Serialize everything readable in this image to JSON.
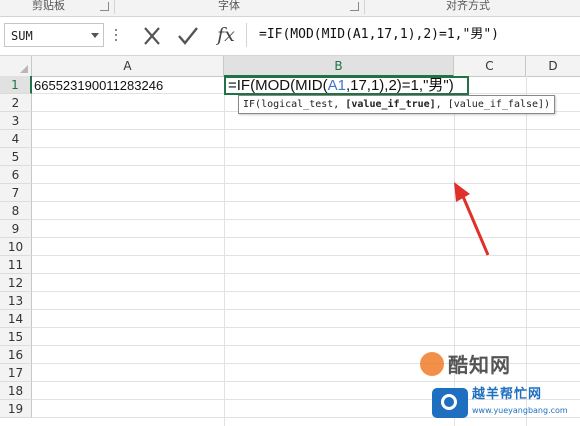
{
  "ribbon": {
    "groups": [
      "剪贴板",
      "字体",
      "对齐方式"
    ]
  },
  "formula_bar": {
    "name_box": "SUM",
    "cancel_label": "×",
    "enter_label": "✓",
    "function_label": "fx",
    "formula": "=IF(MOD(MID(A1,17,1),2)=1,\"男\")"
  },
  "columns": [
    "A",
    "B",
    "C",
    "D"
  ],
  "rows": [
    "1",
    "2",
    "3",
    "4",
    "5",
    "6",
    "7",
    "8",
    "9",
    "10",
    "11",
    "12",
    "13",
    "14",
    "15",
    "16",
    "17",
    "18",
    "19"
  ],
  "cells": {
    "A1": "665523190011283246",
    "B1_prefix": "=IF(MOD(MID(",
    "B1_ref": "A1",
    "B1_suffix": ",17,1),2)=1,\"男\")"
  },
  "tooltip": {
    "fn": "IF(",
    "arg1": "logical_test, ",
    "arg2": "[value_if_true]",
    "sep": ", ",
    "arg3": "[value_if_false]",
    "close": ")"
  },
  "watermark": {
    "line1": "酷知网",
    "line2": "越羊帮忙网",
    "url": "www.yueyangbang.com"
  },
  "colors": {
    "accent": "#217346",
    "reference": "#4472c4",
    "arrow": "#e0302a"
  },
  "icons": [
    "cancel-icon",
    "check-icon",
    "function-icon",
    "dropdown-icon"
  ]
}
